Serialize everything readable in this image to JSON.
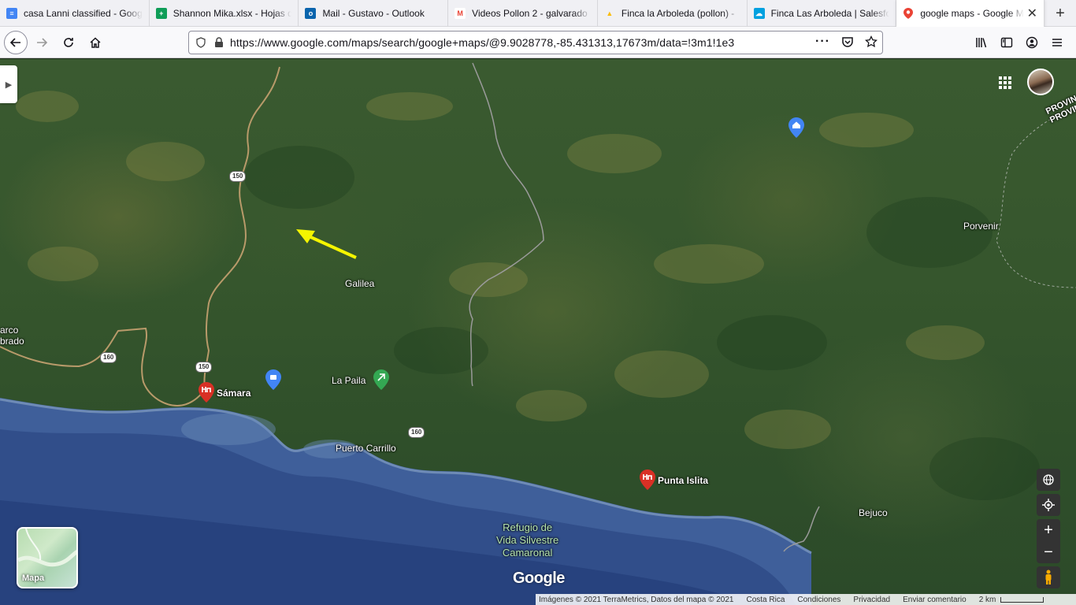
{
  "tabs": [
    {
      "title": "casa Lanni classified - Goog",
      "icon": "docs-icon",
      "color": "#4285f4",
      "glyph": "≡"
    },
    {
      "title": "Shannon Mika.xlsx - Hojas d",
      "icon": "sheets-icon",
      "color": "#0f9d58",
      "glyph": "+"
    },
    {
      "title": "Mail - Gustavo - Outlook",
      "icon": "outlook-icon",
      "color": "#0a64ad",
      "glyph": "o"
    },
    {
      "title": "Videos Pollon 2 - galvarado",
      "icon": "gmail-icon",
      "color": "#ea4335",
      "glyph": "M"
    },
    {
      "title": "Finca la Arboleda (pollon) - ",
      "icon": "drive-icon",
      "color": "#fbbc04",
      "glyph": "▲"
    },
    {
      "title": "Finca Las Arboleda | Salesfo",
      "icon": "salesforce-icon",
      "color": "#00a1e0",
      "glyph": "☁"
    },
    {
      "title": "google maps - Google M",
      "icon": "maps-icon",
      "color": "#34a853",
      "glyph": "●",
      "active": true
    }
  ],
  "url": "https://www.google.com/maps/search/google+maps/@9.9028778,-85.431313,17673m/data=!3m1!1e3",
  "places": {
    "galilea": "Galilea",
    "la_paila": "La Paila",
    "samara": "Sámara",
    "puerto_carrillo": "Puerto Carrillo",
    "punta_islita": "Punta Islita",
    "porvenir": "Porvenir",
    "bejuco": "Bejuco",
    "refugio": "Refugio de\nVida Silvestre\nCamaronal",
    "arco_brado": "arco\nbrado",
    "provincia": "PROVIN\nPROVIN"
  },
  "roads": {
    "r150_a": "150",
    "r150_b": "150",
    "r160_a": "160",
    "r160_b": "160"
  },
  "layer_label": "Mapa",
  "logo": "Google",
  "footer": {
    "imagery": "Imágenes © 2021 TerraMetrics, Datos del mapa © 2021",
    "country": "Costa Rica",
    "terms": "Condiciones",
    "privacy": "Privacidad",
    "feedback": "Enviar comentario",
    "scale": "2 km"
  },
  "colors": {
    "arrow": "#f5f500",
    "pin_red": "#d93025",
    "pin_blue": "#4285f4",
    "pin_green": "#34a853"
  }
}
